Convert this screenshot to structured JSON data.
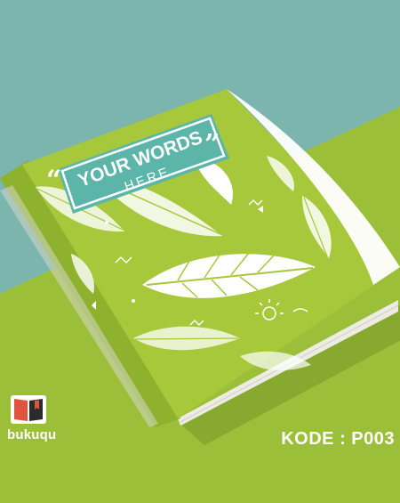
{
  "cover": {
    "title_line1": "YOUR WORDS",
    "title_line2": "HERE",
    "open_quote": "“",
    "close_quote": "”"
  },
  "brand": {
    "name": "bukuqu",
    "icon": "open-book-icon"
  },
  "product": {
    "code_label": "KODE : P003"
  },
  "colors": {
    "background_teal": "#7bb5ae",
    "background_green": "#9cbf3a",
    "cover_green": "#a6c83a",
    "label_teal": "#5bb5a8",
    "leaf_white": "#ffffff",
    "brand_red": "#e0533c"
  }
}
